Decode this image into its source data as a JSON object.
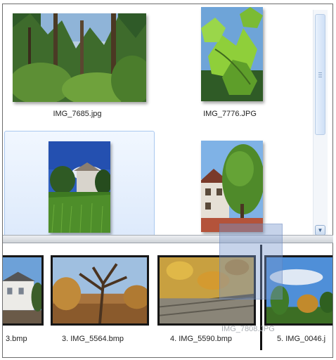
{
  "browser": {
    "items": [
      {
        "caption": "IMG_7685.jpg"
      },
      {
        "caption": "IMG_7776.JPG"
      },
      {
        "caption": ""
      },
      {
        "caption": ""
      }
    ]
  },
  "filmstrip": {
    "items": [
      {
        "caption": "3.bmp"
      },
      {
        "caption": "3. IMG_5564.bmp"
      },
      {
        "caption": "4. IMG_5590.bmp"
      },
      {
        "caption": "5. IMG_0046.j"
      }
    ]
  },
  "drag": {
    "label": "IMG_7808.JPG"
  },
  "icons": {
    "scroll_down": "chevron-down-icon",
    "scroll_grip": "grip-icon"
  }
}
